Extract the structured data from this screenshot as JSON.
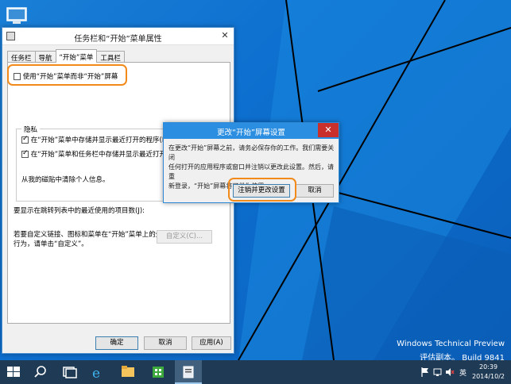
{
  "colors": {
    "desktop_blue": "#0d6fcf",
    "highlight_orange": "#f28a1b",
    "taskbar": "#1f3a55",
    "dialog_titlebar": "#2b8ee0"
  },
  "main_window": {
    "title": "任务栏和“开始”菜单属性",
    "close_glyph": "✕",
    "tabs": [
      {
        "label": "任务栏"
      },
      {
        "label": "导航"
      },
      {
        "label": "“开始”菜单"
      },
      {
        "label": "工具栏"
      }
    ],
    "use_start_menu_label": "使用“开始”菜单而非“开始”屏幕",
    "privacy_label": "隐私",
    "privacy_option1": "在“开始”菜单中存储并显示最近打开的程序(P)",
    "privacy_option2": "在“开始”菜单和任务栏中存储并显示最近打开的项目(M)",
    "clear_info": "从我的磁贴中清除个人信息。",
    "jumplist_label": "要显示在跳转列表中的最近使用的项目数(J):",
    "customize_text_line1": "若要自定义链接、图标和菜单在“开始”菜单上的外观和",
    "customize_text_line2": "行为，请单击“自定义”。",
    "customize_button": "自定义(C)...",
    "ok_button": "确定",
    "cancel_button": "取消",
    "apply_button": "应用(A)"
  },
  "dialog": {
    "title": "更改“开始”屏幕设置",
    "close_glyph": "✕",
    "message_line1": "在更改“开始”屏幕之前，请务必保存你的工作。我们需要关闭",
    "message_line2": "任何打开的应用程序或窗口并注销以更改此设置。然后，请重",
    "message_line3": "新登录，“开始”屏幕将可供你使用。",
    "signout_button": "注销并更改设置",
    "cancel_button": "取消"
  },
  "watermark": {
    "line1": "Windows Technical Preview",
    "line2": "评估副本。 Build 9841"
  },
  "taskbar": {
    "items": [
      {
        "icon": "windows-start-icon"
      },
      {
        "icon": "search-icon"
      },
      {
        "icon": "task-view-icon"
      },
      {
        "icon": "internet-explorer-icon"
      },
      {
        "icon": "file-explorer-icon"
      },
      {
        "icon": "store-icon"
      },
      {
        "icon": "taskbar-properties-icon"
      }
    ],
    "tray": {
      "ime_label": "英",
      "time": "20:39",
      "date": "2014/10/2"
    }
  }
}
